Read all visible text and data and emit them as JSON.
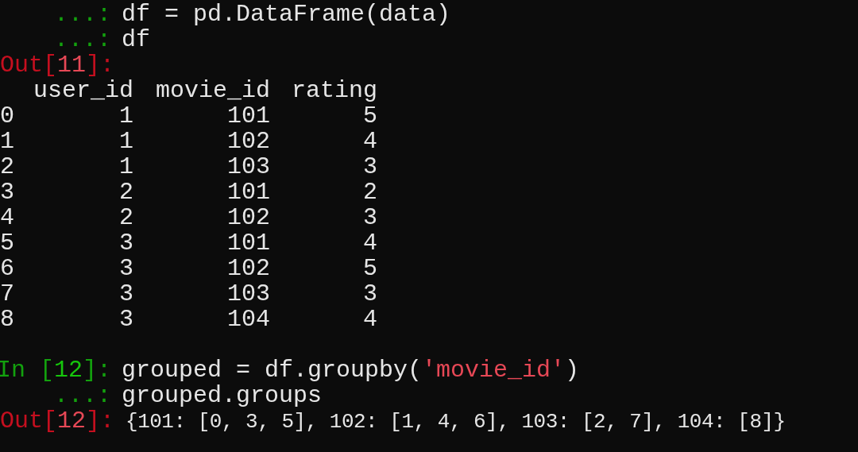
{
  "lines": [
    {
      "kind": "input",
      "prompt": {
        "before": "...:"
      },
      "code": [
        {
          "kind": "plain",
          "text": "df = pd.DataFrame(data)"
        }
      ]
    },
    {
      "kind": "input",
      "prompt": {
        "before": "...:"
      },
      "code": [
        {
          "kind": "plain",
          "text": "df"
        }
      ]
    },
    {
      "kind": "output",
      "prompt": {
        "before": "Out[",
        "number": "11",
        "after": "]:"
      }
    },
    {
      "kind": "table",
      "columns": [
        "user_id",
        "movie_id",
        "rating"
      ],
      "rows": [
        {
          "index": "0",
          "cells": [
            "1",
            "101",
            "5"
          ]
        },
        {
          "index": "1",
          "cells": [
            "1",
            "102",
            "4"
          ]
        },
        {
          "index": "2",
          "cells": [
            "1",
            "103",
            "3"
          ]
        },
        {
          "index": "3",
          "cells": [
            "2",
            "101",
            "2"
          ]
        },
        {
          "index": "4",
          "cells": [
            "2",
            "102",
            "3"
          ]
        },
        {
          "index": "5",
          "cells": [
            "3",
            "101",
            "4"
          ]
        },
        {
          "index": "6",
          "cells": [
            "3",
            "102",
            "5"
          ]
        },
        {
          "index": "7",
          "cells": [
            "3",
            "103",
            "3"
          ]
        },
        {
          "index": "8",
          "cells": [
            "3",
            "104",
            "4"
          ]
        }
      ]
    },
    {
      "kind": "blank"
    },
    {
      "kind": "input",
      "prompt": {
        "before": "In [",
        "number": "12",
        "after": "]:"
      },
      "code": [
        {
          "kind": "plain",
          "text": "grouped = df.groupby("
        },
        {
          "kind": "string",
          "text": "'movie_id'"
        },
        {
          "kind": "plain",
          "text": ")"
        }
      ]
    },
    {
      "kind": "input",
      "prompt": {
        "before": "...:"
      },
      "code": [
        {
          "kind": "plain",
          "text": "grouped.groups"
        }
      ]
    },
    {
      "kind": "output",
      "prompt": {
        "before": "Out[",
        "number": "12",
        "after": "]:"
      },
      "text": "{101: [0, 3, 5], 102: [1, 4, 6], 103: [2, 7], 104: [8]}"
    }
  ]
}
